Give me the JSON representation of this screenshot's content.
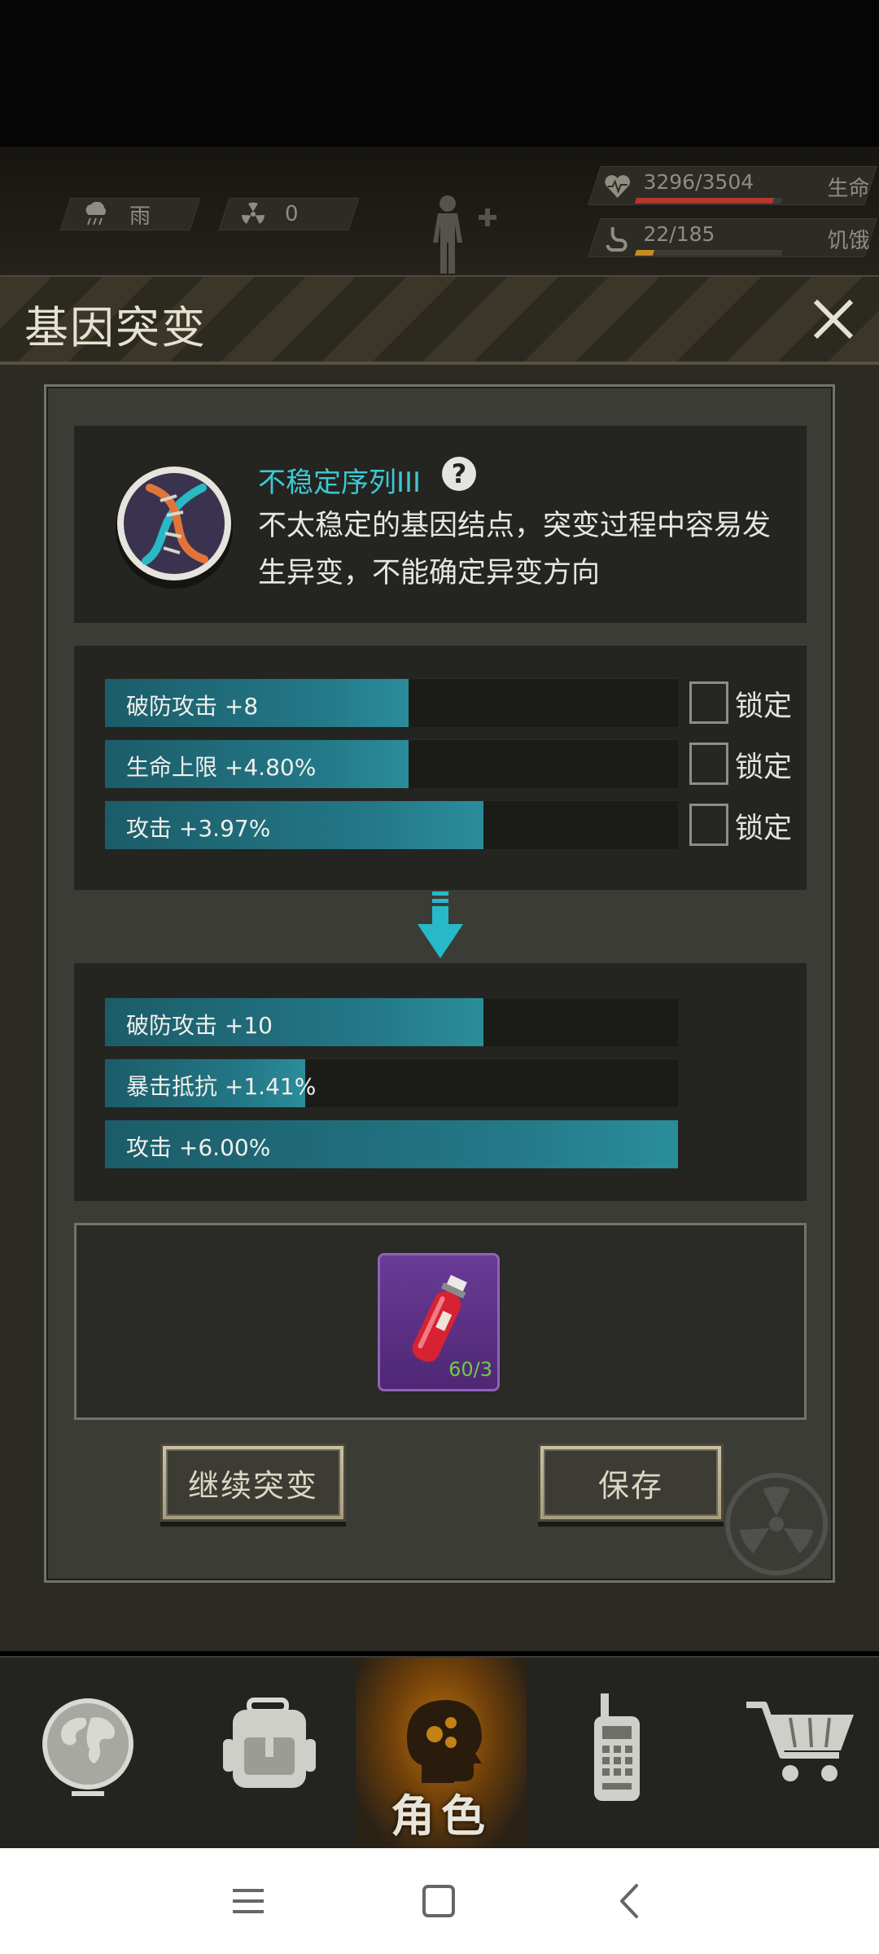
{
  "status_bar": {
    "weather": {
      "icon": "rain-cloud-icon",
      "label": "雨"
    },
    "radiation": {
      "icon": "radiation-icon",
      "value": "0"
    },
    "character_icon": "body-plus-icon",
    "health": {
      "icon": "heart-icon",
      "text": "3296/3504",
      "label": "生命",
      "fraction": 0.94,
      "color": "#b8372c"
    },
    "hunger": {
      "icon": "stomach-icon",
      "text": "22/185",
      "label": "饥饿",
      "fraction": 0.12,
      "color": "#c98a26"
    }
  },
  "dialog": {
    "title": "基因突变",
    "gene": {
      "icon": "dna-icon",
      "name": "不稳定序列III",
      "description": "不太稳定的基因结点，突变过程中容易发生异变，不能确定异变方向"
    },
    "current_attributes": [
      {
        "text": "破防攻击 +8",
        "fraction": 0.53,
        "lock_label": "锁定"
      },
      {
        "text": "生命上限 +4.80%",
        "fraction": 0.53,
        "lock_label": "锁定"
      },
      {
        "text": "攻击 +3.97%",
        "fraction": 0.66,
        "lock_label": "锁定"
      }
    ],
    "result_attributes": [
      {
        "text": "破防攻击 +10",
        "fraction": 0.66
      },
      {
        "text": "暴击抵抗 +1.41%",
        "fraction": 0.35
      },
      {
        "text": "攻击 +6.00%",
        "fraction": 1.0
      }
    ],
    "item": {
      "icon": "red-vial-icon",
      "count": "60/3"
    },
    "continue_label": "继续突变",
    "save_label": "保存"
  },
  "bottom_nav": [
    {
      "icon": "globe-icon",
      "label": ""
    },
    {
      "icon": "backpack-icon",
      "label": ""
    },
    {
      "icon": "head-icon",
      "label": "角色",
      "active": true
    },
    {
      "icon": "walkie-talkie-icon",
      "label": ""
    },
    {
      "icon": "cart-icon",
      "label": ""
    }
  ],
  "system_nav": [
    "menu-icon",
    "home-icon",
    "back-icon"
  ]
}
